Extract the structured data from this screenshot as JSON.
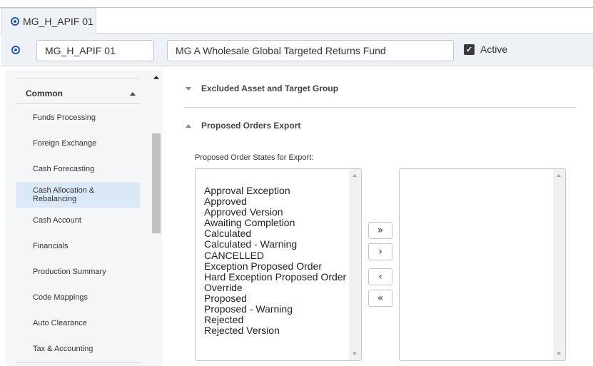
{
  "tab": {
    "label": "MG_H_APIF 01"
  },
  "header": {
    "code_value": "MG_H_APIF 01",
    "name_value": "MG A Wholesale Global Targeted Returns Fund",
    "active_label": "Active",
    "active_checked": true
  },
  "sidebar": {
    "section_label": "Common",
    "items": [
      {
        "label": "Funds Processing"
      },
      {
        "label": "Foreign Exchange"
      },
      {
        "label": "Cash Forecasting"
      },
      {
        "label": "Cash Allocation & Rebalancing"
      },
      {
        "label": "Cash Account"
      },
      {
        "label": "Financials"
      },
      {
        "label": "Production Summary"
      },
      {
        "label": "Code Mappings"
      },
      {
        "label": "Auto Clearance"
      },
      {
        "label": "Tax & Accounting"
      }
    ],
    "selected_index": 3
  },
  "main": {
    "excluded_section_label": "Excluded Asset and Target Group",
    "export_section_label": "Proposed Orders Export",
    "states_label": "Proposed Order States for Export:",
    "available_states": [
      "Approval Exception",
      "Approved",
      "Approved Version",
      "Awaiting Completion",
      "Calculated",
      "Calculated - Warning",
      "CANCELLED",
      "Exception Proposed Order",
      "Hard Exception Proposed Order",
      "Override",
      "Proposed",
      "Proposed - Warning",
      "Rejected",
      "Rejected Version"
    ],
    "selected_states": [],
    "buttons": {
      "move_all_right": "»",
      "move_right": "›",
      "move_left": "‹",
      "move_all_left": "«"
    }
  },
  "icons": {
    "tab_radio": "radio-selected-icon",
    "collapse_caret": "caret-up-icon",
    "expand_caret": "caret-down-icon",
    "checkbox": "checkmark-icon"
  },
  "colors": {
    "accent": "#1f5bb5",
    "selected_bg": "#dbe8f8",
    "panel_bg": "#eef1f5"
  }
}
